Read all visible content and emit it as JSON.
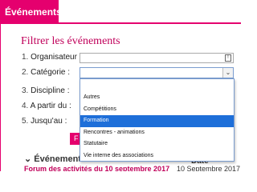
{
  "header": {
    "tab_label": "Événements"
  },
  "filter": {
    "title": "Filtrer les événements",
    "rows": [
      {
        "num": "1.",
        "label": "Organisateur :"
      },
      {
        "num": "2.",
        "label": "Catégorie :"
      },
      {
        "num": "3.",
        "label": "Discipline :"
      },
      {
        "num": "4.",
        "label": "A partir du :"
      },
      {
        "num": "5.",
        "label": "Jusqu'au :"
      }
    ],
    "organisateur_icon": "!",
    "category_arrow": "⌄",
    "category_options": [
      "Autres",
      "Compétitions",
      "Formation",
      "Rencontres - animations",
      "Statutaire",
      "Vie interne des associations"
    ],
    "category_highlighted": "Formation",
    "apply_button_label": "F"
  },
  "results": {
    "sort_label": "Événement",
    "sort_icon": "⌄",
    "date_header": "Date",
    "rows": [
      {
        "title": "Forum des activités du 10 septembre 2017",
        "date": "10 Septembre 2017"
      }
    ]
  },
  "colors": {
    "accent": "#e5006e",
    "title": "#c0005a",
    "highlight": "#1e6fd9"
  }
}
